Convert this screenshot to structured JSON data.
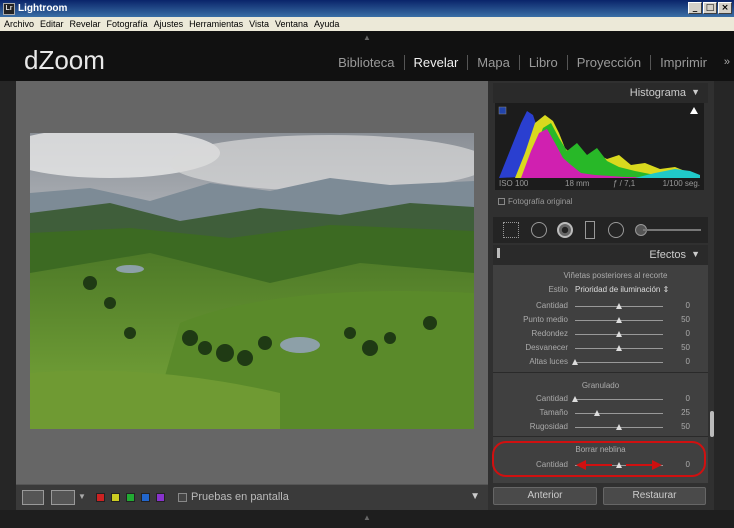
{
  "window": {
    "title": "Lightroom",
    "app_icon": "Lr",
    "controls": [
      "_",
      "□",
      "×"
    ]
  },
  "menu": [
    "Archivo",
    "Editar",
    "Revelar",
    "Fotografía",
    "Ajustes",
    "Herramientas",
    "Vista",
    "Ventana",
    "Ayuda"
  ],
  "identity": "dZoom",
  "modules": [
    "Biblioteca",
    "Revelar",
    "Mapa",
    "Libro",
    "Proyección",
    "Imprimir"
  ],
  "active_module": "Revelar",
  "histogram": {
    "title": "Histograma",
    "iso": "ISO 100",
    "focal": "18 mm",
    "aperture": "ƒ / 7,1",
    "shutter": "1/100 seg.",
    "original_label": "Fotografía original"
  },
  "effects": {
    "title": "Efectos",
    "vignette": {
      "title": "Viñetas posteriores al recorte",
      "style_label": "Estilo",
      "style_value": "Prioridad de iluminación ⇕",
      "sliders": [
        {
          "label": "Cantidad",
          "value": "0",
          "pos": 0.5
        },
        {
          "label": "Punto medio",
          "value": "50",
          "pos": 0.5
        },
        {
          "label": "Redondez",
          "value": "0",
          "pos": 0.5
        },
        {
          "label": "Desvanecer",
          "value": "50",
          "pos": 0.5
        },
        {
          "label": "Altas luces",
          "value": "0",
          "pos": 0.0
        }
      ]
    },
    "grain": {
      "title": "Granulado",
      "sliders": [
        {
          "label": "Cantidad",
          "value": "0",
          "pos": 0.0
        },
        {
          "label": "Tamaño",
          "value": "25",
          "pos": 0.25
        },
        {
          "label": "Rugosidad",
          "value": "50",
          "pos": 0.5
        }
      ]
    },
    "dehaze": {
      "title": "Borrar neblina",
      "sliders": [
        {
          "label": "Cantidad",
          "value": "0",
          "pos": 0.5
        }
      ]
    }
  },
  "buttons": {
    "previous": "Anterior",
    "reset": "Restaurar"
  },
  "toolbar": {
    "softproof": "Pruebas en pantalla",
    "swatches": [
      "#cc2222",
      "#cccc22",
      "#22aa33",
      "#2266cc",
      "#8833cc"
    ]
  },
  "colors": {
    "annotation": "#d01010"
  }
}
